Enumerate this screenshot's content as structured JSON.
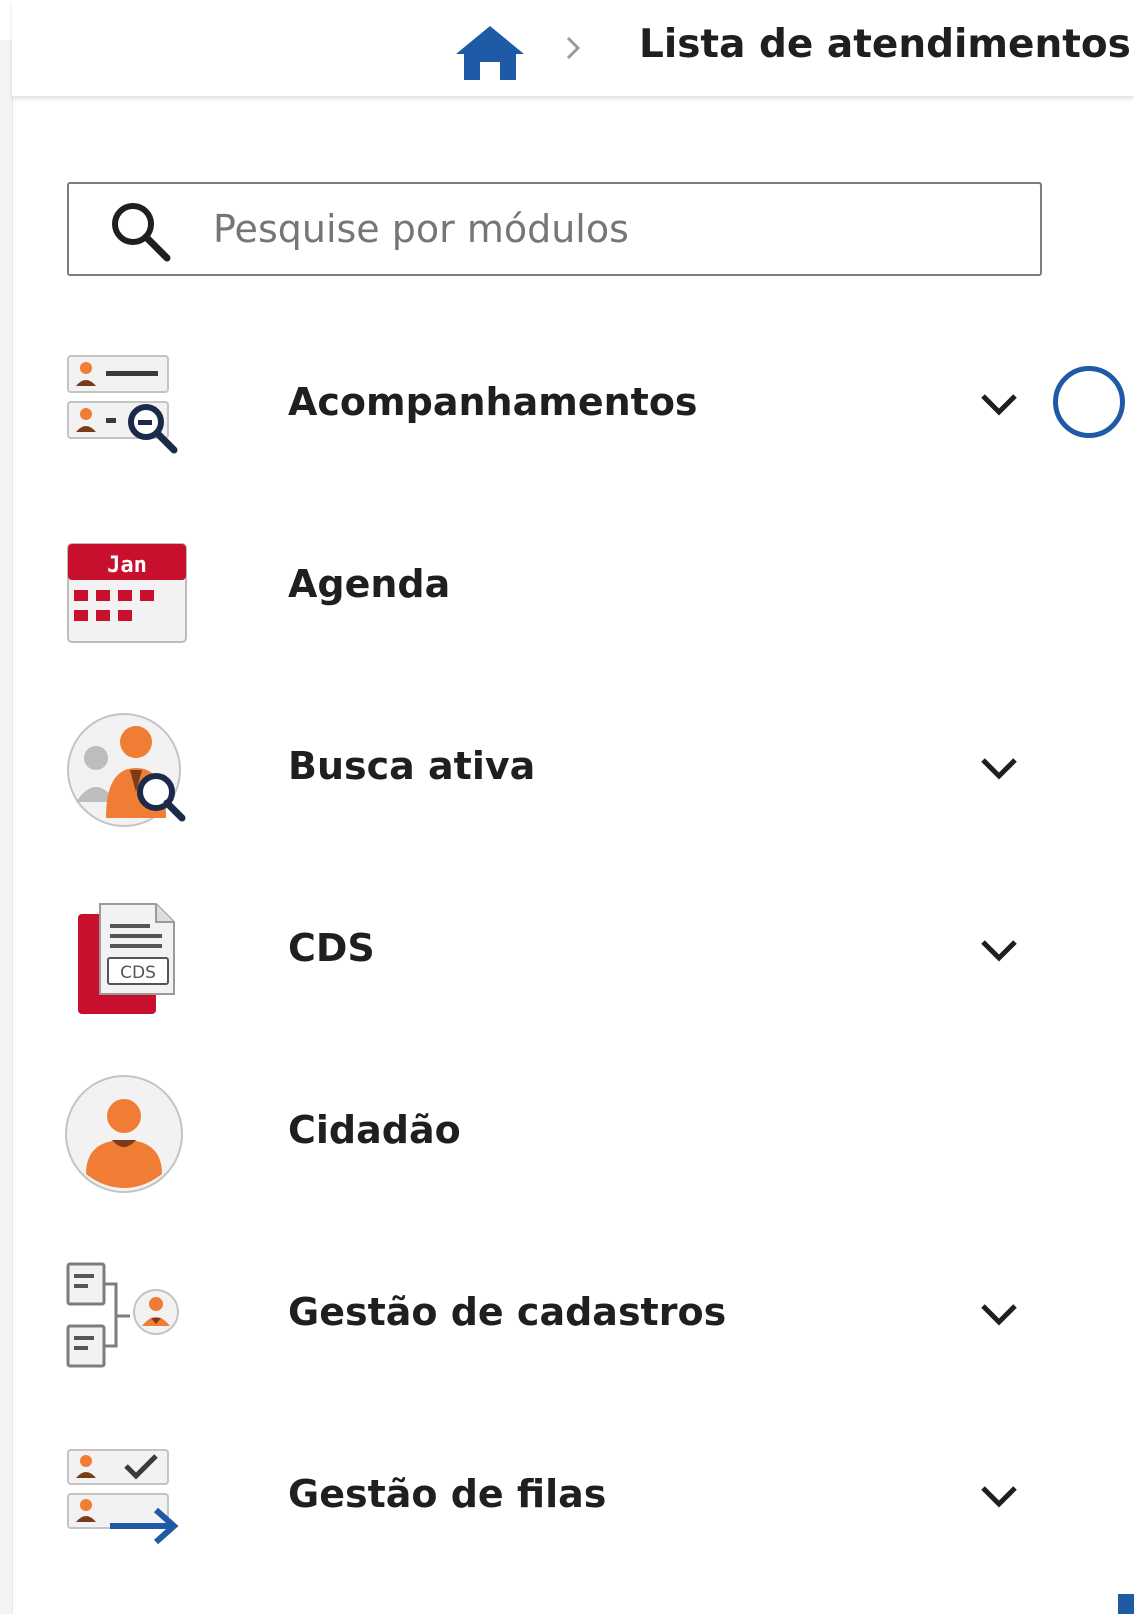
{
  "breadcrumb": {
    "home_icon": "home-icon",
    "separator_icon": "chevron-right-icon",
    "current": "Lista de atendimentos"
  },
  "search": {
    "icon": "search-icon",
    "placeholder": "Pesquise por módulos",
    "value": ""
  },
  "menu": {
    "items": [
      {
        "label": "Acompanhamentos",
        "icon": "acompanhamentos-icon",
        "expandable": true
      },
      {
        "label": "Agenda",
        "icon": "calendar-icon",
        "icon_text": "Jan",
        "expandable": false
      },
      {
        "label": "Busca ativa",
        "icon": "busca-ativa-icon",
        "expandable": true
      },
      {
        "label": "CDS",
        "icon": "cds-document-icon",
        "icon_text": "CDS",
        "expandable": true
      },
      {
        "label": "Cidadão",
        "icon": "citizen-avatar-icon",
        "expandable": false
      },
      {
        "label": "Gestão de cadastros",
        "icon": "gestao-cadastros-icon",
        "expandable": true
      },
      {
        "label": "Gestão de filas",
        "icon": "gestao-filas-icon",
        "expandable": true
      }
    ]
  },
  "colors": {
    "brand_blue": "#1f5aa6",
    "accent_red": "#c8102e",
    "accent_orange": "#f07d33",
    "text": "#1f1f1f"
  }
}
